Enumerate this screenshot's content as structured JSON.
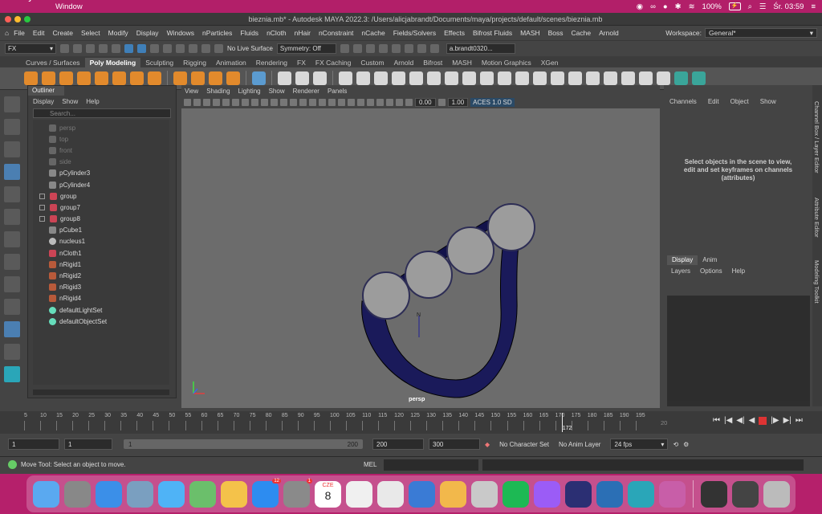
{
  "mac_menubar": {
    "app": "Maya",
    "menu": "Window",
    "battery": "100%",
    "clock": "Śr. 03:59"
  },
  "window": {
    "title": "bieznia.mb* - Autodesk MAYA 2022.3: /Users/alicjabrandt/Documents/maya/projects/default/scenes/bieznia.mb"
  },
  "menus": [
    "File",
    "Edit",
    "Create",
    "Select",
    "Modify",
    "Display",
    "Windows",
    "nParticles",
    "Fluids",
    "nCloth",
    "nHair",
    "nConstraint",
    "nCache",
    "Fields/Solvers",
    "Effects",
    "Bifrost Fluids",
    "MASH",
    "Boss",
    "Cache",
    "Arnold"
  ],
  "workspace": {
    "label": "Workspace:",
    "value": "General*"
  },
  "status_line": {
    "menuset": "FX",
    "live_surface": "No Live Surface",
    "symmetry": "Symmetry: Off",
    "user": "a.brandt0320..."
  },
  "shelf_tabs": [
    "Curves / Surfaces",
    "Poly Modeling",
    "Sculpting",
    "Rigging",
    "Animation",
    "Rendering",
    "FX",
    "FX Caching",
    "Custom",
    "Arnold",
    "Bifrost",
    "MASH",
    "Motion Graphics",
    "XGen"
  ],
  "active_shelf": "Poly Modeling",
  "outliner": {
    "tab": "Outliner",
    "menu": [
      "Display",
      "Show",
      "Help"
    ],
    "search_placeholder": "Search...",
    "items": [
      {
        "name": "persp",
        "icon": "camera-icon",
        "dim": true
      },
      {
        "name": "top",
        "icon": "camera-icon",
        "dim": true
      },
      {
        "name": "front",
        "icon": "camera-icon",
        "dim": true
      },
      {
        "name": "side",
        "icon": "camera-icon",
        "dim": true
      },
      {
        "name": "pCylinder3",
        "icon": "mesh-icon"
      },
      {
        "name": "pCylinder4",
        "icon": "mesh-icon"
      },
      {
        "name": "group",
        "icon": "group-icon",
        "expand": true
      },
      {
        "name": "group7",
        "icon": "group-icon",
        "expand": true
      },
      {
        "name": "group8",
        "icon": "group-icon",
        "expand": true
      },
      {
        "name": "pCube1",
        "icon": "mesh-icon"
      },
      {
        "name": "nucleus1",
        "icon": "nucleus-icon"
      },
      {
        "name": "nCloth1",
        "icon": "ncloth-icon"
      },
      {
        "name": "nRigid1",
        "icon": "nrigid-icon"
      },
      {
        "name": "nRigid2",
        "icon": "nrigid-icon"
      },
      {
        "name": "nRigid3",
        "icon": "nrigid-icon"
      },
      {
        "name": "nRigid4",
        "icon": "nrigid-icon"
      },
      {
        "name": "defaultLightSet",
        "icon": "set-icon"
      },
      {
        "name": "defaultObjectSet",
        "icon": "set-icon"
      }
    ]
  },
  "viewport": {
    "menu": [
      "View",
      "Shading",
      "Lighting",
      "Show",
      "Renderer",
      "Panels"
    ],
    "exposure": "0.00",
    "gamma": "1.00",
    "colorspace": "ACES 1.0 SD",
    "camera_label": "persp"
  },
  "channel_box": {
    "menu": [
      "Channels",
      "Edit",
      "Object",
      "Show"
    ],
    "message": "Select objects in the scene to view, edit and set keyframes on channels (attributes)"
  },
  "layer_editor": {
    "tabs": [
      "Display",
      "Anim"
    ],
    "menu": [
      "Layers",
      "Options",
      "Help"
    ]
  },
  "side_tabs": [
    "Channel Box / Layer Editor",
    "Attribute Editor",
    "Modeling Toolkit"
  ],
  "timeline": {
    "ticks": [
      5,
      10,
      15,
      20,
      25,
      30,
      35,
      40,
      45,
      50,
      55,
      60,
      65,
      70,
      75,
      80,
      85,
      90,
      95,
      100,
      105,
      110,
      115,
      120,
      125,
      130,
      135,
      140,
      145,
      150,
      155,
      160,
      165,
      170,
      175,
      180,
      185,
      190,
      195
    ],
    "current_frame": "172",
    "end_frame": "20"
  },
  "range": {
    "start": "1",
    "playback_start": "1",
    "slider_start": "1",
    "slider_end": "200",
    "playback_end": "200",
    "end": "300",
    "character_set": "No Character Set",
    "anim_layer": "No Anim Layer",
    "fps": "24 fps"
  },
  "help_line": {
    "text": "Move Tool: Select an object to move.",
    "mel": "MEL"
  },
  "dock": {
    "calendar_month": "CZE",
    "calendar_day": "8",
    "appstore_badge": "12",
    "settings_badge": "1"
  }
}
